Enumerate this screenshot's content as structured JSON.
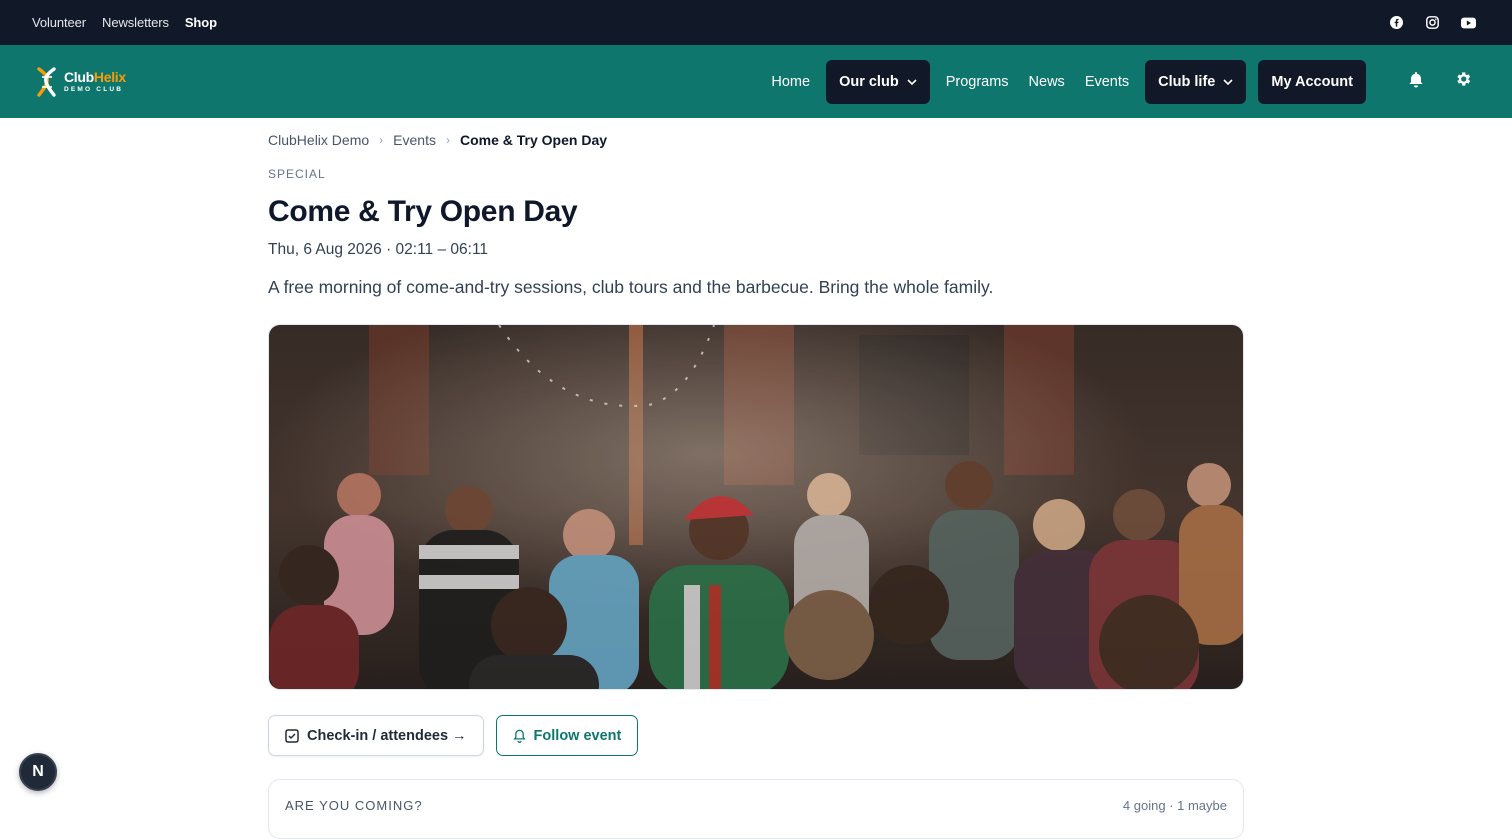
{
  "topbar": {
    "links": [
      "Volunteer",
      "Newsletters",
      "Shop"
    ],
    "social_icons": [
      "facebook-icon",
      "instagram-icon",
      "youtube-icon"
    ]
  },
  "brand": {
    "name_part1": "Club",
    "name_part2": "Helix",
    "subtitle": "DEMO CLUB",
    "accent_color": "#f59e0b",
    "nav_color": "#0f766e"
  },
  "nav": {
    "home": "Home",
    "our_club": "Our club",
    "programs": "Programs",
    "news": "News",
    "events": "Events",
    "club_life": "Club life",
    "account": "My Account",
    "icons": [
      "bell-icon",
      "gear-icon"
    ]
  },
  "breadcrumb": {
    "items": [
      "ClubHelix Demo",
      "Events"
    ],
    "current": "Come & Try Open Day"
  },
  "event": {
    "category": "SPECIAL",
    "title": "Come & Try Open Day",
    "datetime": "Thu, 6 Aug 2026 · 02:11 – 06:11",
    "description": "A free morning of come-and-try sessions, club tours and the barbecue. Bring the whole family.",
    "image_alt": "Crowd of people at an outdoor gathering with string lights"
  },
  "actions": {
    "checkin": "Check-in / attendees →",
    "follow": "Follow event"
  },
  "rsvp": {
    "question": "ARE YOU COMING?",
    "summary": "4 going · 1 maybe"
  },
  "dev_badge": "N"
}
